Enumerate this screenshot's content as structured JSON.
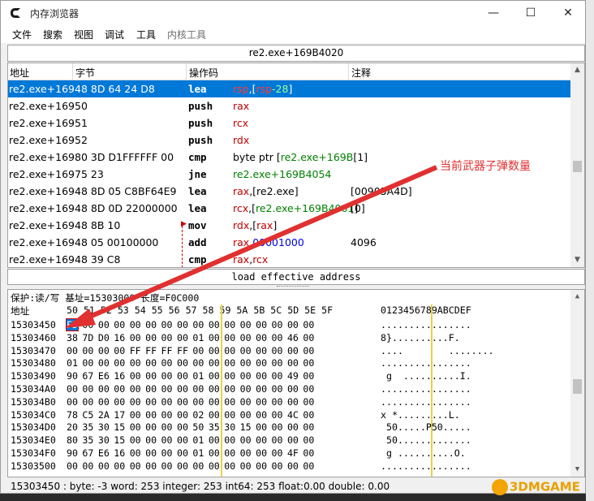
{
  "window": {
    "title": "内存浏览器"
  },
  "title_buttons": {
    "minimize": "—",
    "maximize": "☐",
    "close": "✕"
  },
  "menu": [
    "文件",
    "搜索",
    "视图",
    "调试",
    "工具",
    "内核工具"
  ],
  "disassembler": {
    "address_bar": "re2.exe+169B4020",
    "columns": [
      "地址",
      "字节",
      "操作码",
      "注释"
    ],
    "rows": [
      {
        "addr": "re2.exe+169",
        "bytes": "48 8D 64 24 D8",
        "op": "lea",
        "args": [
          {
            "t": "rsp",
            "c": "reg"
          },
          {
            "t": ",[",
            "c": ""
          },
          {
            "t": "rsp",
            "c": "reg"
          },
          {
            "t": "-28",
            "c": "grn"
          },
          {
            "t": "]",
            "c": ""
          }
        ],
        "comment": ""
      },
      {
        "addr": "re2.exe+169",
        "bytes": "50",
        "op": "push",
        "args": [
          {
            "t": "rax",
            "c": "reg"
          }
        ],
        "comment": ""
      },
      {
        "addr": "re2.exe+169",
        "bytes": "51",
        "op": "push",
        "args": [
          {
            "t": "rcx",
            "c": "reg"
          }
        ],
        "comment": ""
      },
      {
        "addr": "re2.exe+169",
        "bytes": "52",
        "op": "push",
        "args": [
          {
            "t": "rdx",
            "c": "reg"
          }
        ],
        "comment": ""
      },
      {
        "addr": "re2.exe+169",
        "bytes": "80 3D D1FFFFFF 00",
        "op": "cmp",
        "args": [
          {
            "t": "byte ptr [",
            "c": ""
          },
          {
            "t": "re2.exe+169B",
            "c": "sym"
          },
          {
            "t": "[1]",
            "c": ""
          }
        ],
        "comment": ""
      },
      {
        "addr": "re2.exe+169",
        "bytes": "75 23",
        "op": "jne",
        "args": [
          {
            "t": "re2.exe+169B4054",
            "c": "sym"
          }
        ],
        "comment": ""
      },
      {
        "addr": "re2.exe+169",
        "bytes": "48 8D 05 C8BF64E9",
        "op": "lea",
        "args": [
          {
            "t": "rax",
            "c": "reg"
          },
          {
            "t": ",[re2.exe]",
            "c": ""
          }
        ],
        "comment": "[00905A4D]"
      },
      {
        "addr": "re2.exe+169",
        "bytes": "48 8D 0D 22000000",
        "op": "lea",
        "args": [
          {
            "t": "rcx",
            "c": "reg"
          },
          {
            "t": ",[",
            "c": ""
          },
          {
            "t": "re2.exe+169B4061",
            "c": "sym"
          },
          {
            "t": "]",
            "c": ""
          }
        ],
        "comment": "[0]"
      },
      {
        "addr": "re2.exe+169",
        "bytes": "48 8B 10",
        "op": "mov",
        "args": [
          {
            "t": "rdx",
            "c": "reg"
          },
          {
            "t": ",[",
            "c": ""
          },
          {
            "t": "rax",
            "c": "reg"
          },
          {
            "t": "]",
            "c": ""
          }
        ],
        "comment": ""
      },
      {
        "addr": "re2.exe+169",
        "bytes": "48 05 00100000",
        "op": "add",
        "args": [
          {
            "t": "rax",
            "c": "reg"
          },
          {
            "t": ",",
            "c": ""
          },
          {
            "t": "00001000",
            "c": "num"
          }
        ],
        "comment": "4096"
      },
      {
        "addr": "re2.exe+169",
        "bytes": "48 39 C8",
        "op": "cmp",
        "args": [
          {
            "t": "rax",
            "c": "reg"
          },
          {
            "t": ",",
            "c": ""
          },
          {
            "t": "rcx",
            "c": "reg"
          }
        ],
        "comment": ""
      }
    ],
    "description": "load effective address"
  },
  "hex": {
    "info": "保护:读/写   基址=15303000 长度=F0C000",
    "header_label": "地址",
    "header_cols": "50 51 52 53 54 55 56 57 58 59 5A 5B 5C 5D 5E 5F",
    "header_ascii": "0123456789ABCDEF",
    "rows": [
      {
        "addr": "15303450",
        "bytes": [
          "FD",
          "00",
          "00",
          "00",
          "00",
          "00",
          "00",
          "00",
          "00",
          "00",
          "00",
          "00",
          "00",
          "00",
          "00",
          "00"
        ],
        "ascii": "................"
      },
      {
        "addr": "15303460",
        "bytes": [
          "38",
          "7D",
          "D0",
          "16",
          "00",
          "00",
          "00",
          "00",
          "01",
          "00",
          "00",
          "00",
          "00",
          "00",
          "46",
          "00"
        ],
        "ascii": "8}..........F."
      },
      {
        "addr": "15303470",
        "bytes": [
          "00",
          "00",
          "00",
          "00",
          "FF",
          "FF",
          "FF",
          "FF",
          "00",
          "00",
          "00",
          "00",
          "00",
          "00",
          "00",
          "00"
        ],
        "ascii": "....        ........"
      },
      {
        "addr": "15303480",
        "bytes": [
          "01",
          "00",
          "00",
          "00",
          "00",
          "00",
          "00",
          "00",
          "00",
          "00",
          "00",
          "00",
          "00",
          "00",
          "00",
          "00"
        ],
        "ascii": "................"
      },
      {
        "addr": "15303490",
        "bytes": [
          "90",
          "67",
          "E6",
          "16",
          "00",
          "00",
          "00",
          "00",
          "01",
          "00",
          "00",
          "00",
          "00",
          "00",
          "49",
          "00"
        ],
        "ascii": " g  ..........I."
      },
      {
        "addr": "153034A0",
        "bytes": [
          "00",
          "00",
          "00",
          "00",
          "00",
          "00",
          "00",
          "00",
          "00",
          "00",
          "00",
          "00",
          "00",
          "00",
          "00",
          "00"
        ],
        "ascii": "................"
      },
      {
        "addr": "153034B0",
        "bytes": [
          "00",
          "00",
          "00",
          "00",
          "00",
          "00",
          "00",
          "00",
          "00",
          "00",
          "00",
          "00",
          "00",
          "00",
          "00",
          "00"
        ],
        "ascii": "................"
      },
      {
        "addr": "153034C0",
        "bytes": [
          "78",
          "C5",
          "2A",
          "17",
          "00",
          "00",
          "00",
          "00",
          "02",
          "00",
          "00",
          "00",
          "00",
          "00",
          "4C",
          "00"
        ],
        "ascii": "x *.........L."
      },
      {
        "addr": "153034D0",
        "bytes": [
          "20",
          "35",
          "30",
          "15",
          "00",
          "00",
          "00",
          "00",
          "50",
          "35",
          "30",
          "15",
          "00",
          "00",
          "00",
          "00"
        ],
        "ascii": " 50.....P50....."
      },
      {
        "addr": "153034E0",
        "bytes": [
          "80",
          "35",
          "30",
          "15",
          "00",
          "00",
          "00",
          "00",
          "01",
          "00",
          "00",
          "00",
          "00",
          "00",
          "00",
          "00"
        ],
        "ascii": " 50............."
      },
      {
        "addr": "153034F0",
        "bytes": [
          "90",
          "67",
          "E6",
          "16",
          "00",
          "00",
          "00",
          "00",
          "01",
          "00",
          "00",
          "00",
          "00",
          "00",
          "4F",
          "00"
        ],
        "ascii": " g ..........O."
      },
      {
        "addr": "15303500",
        "bytes": [
          "00",
          "00",
          "00",
          "00",
          "00",
          "00",
          "00",
          "00",
          "00",
          "00",
          "00",
          "00",
          "00",
          "00",
          "00",
          "00"
        ],
        "ascii": "................"
      }
    ]
  },
  "status": "15303450 : byte: -3 word: 253 integer: 253 int64: 253 float:0.00 double: 0.00",
  "annotation": "当前武器子弹数量",
  "watermark": "3DMGAME",
  "colors": {
    "selection": "#0078d7",
    "register": "#c00000",
    "symbol": "#008000",
    "number": "#0000e0",
    "annotation": "#e03030"
  }
}
